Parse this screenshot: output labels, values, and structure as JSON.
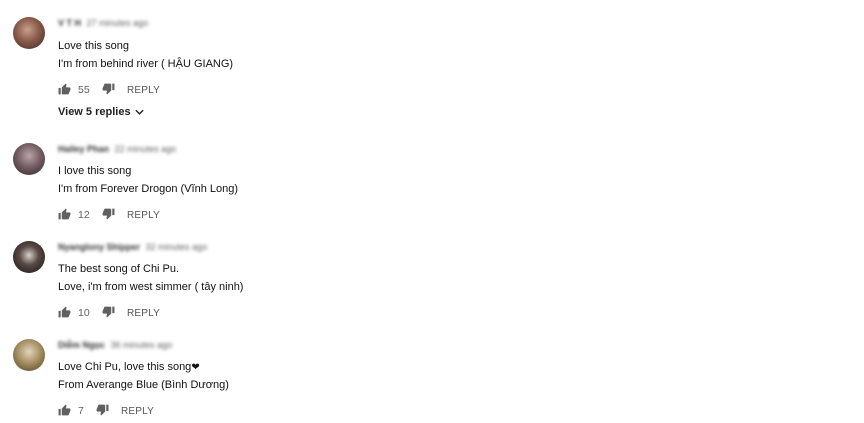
{
  "comments": [
    {
      "author": "V T H",
      "time": "27 minutes ago",
      "lines": [
        "Love this song",
        "I'm from behind river ( HẬU GIANG)"
      ],
      "likes": "55",
      "reply_label": "REPLY",
      "view_replies": "View 5 replies"
    },
    {
      "author": "Hailey Phan",
      "time": "22 minutes ago",
      "lines": [
        "I love this song",
        "I'm from Forever Drogon (Vĩnh Long)"
      ],
      "likes": "12",
      "reply_label": "REPLY"
    },
    {
      "author": "Nyanglony Shipper",
      "time": "32 minutes ago",
      "lines": [
        "The best song of Chi Pu.",
        "Love, i'm from west simmer ( tây ninh)"
      ],
      "likes": "10",
      "reply_label": "REPLY"
    },
    {
      "author": "Diễm Ngọc",
      "time": "36 minutes ago",
      "lines": [
        "Love Chi Pu, love this song",
        "From Averange Blue (Bình Dương)"
      ],
      "heart": "❤",
      "likes": "7",
      "reply_label": "REPLY"
    }
  ],
  "colors": {
    "text": "#111111",
    "meta": "#606060",
    "icon": "#606060"
  }
}
